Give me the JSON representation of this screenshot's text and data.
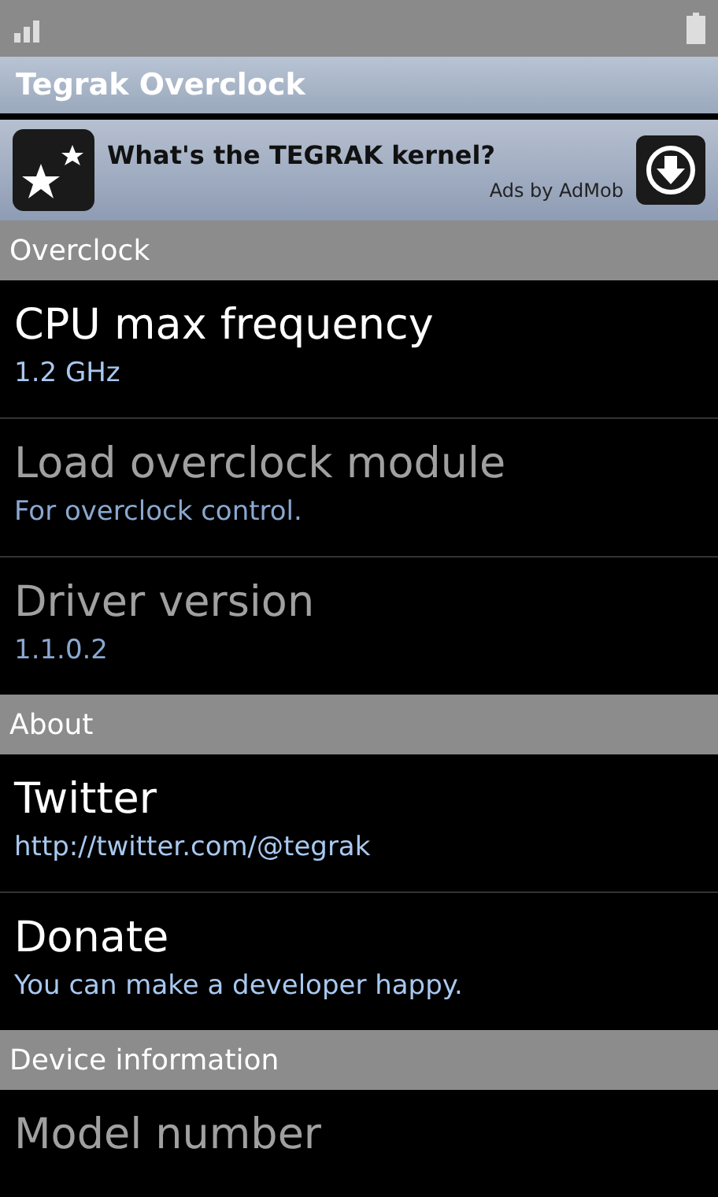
{
  "title_bar": {
    "title": "Tegrak Overclock"
  },
  "ad": {
    "headline": "What's the TEGRAK kernel?",
    "attribution": "Ads by AdMob"
  },
  "sections": [
    {
      "header": "Overclock",
      "items": [
        {
          "title": "CPU max frequency",
          "summary": "1.2 GHz",
          "disabled": false
        },
        {
          "title": "Load overclock module",
          "summary": "For overclock control.",
          "disabled": true
        },
        {
          "title": "Driver version",
          "summary": "1.1.0.2",
          "disabled": true
        }
      ]
    },
    {
      "header": "About",
      "items": [
        {
          "title": "Twitter",
          "summary": "http://twitter.com/@tegrak",
          "disabled": false
        },
        {
          "title": "Donate",
          "summary": "You can make a developer happy.",
          "disabled": false
        }
      ]
    },
    {
      "header": "Device information",
      "items": [
        {
          "title": "Model number",
          "disabled": true
        }
      ]
    }
  ]
}
